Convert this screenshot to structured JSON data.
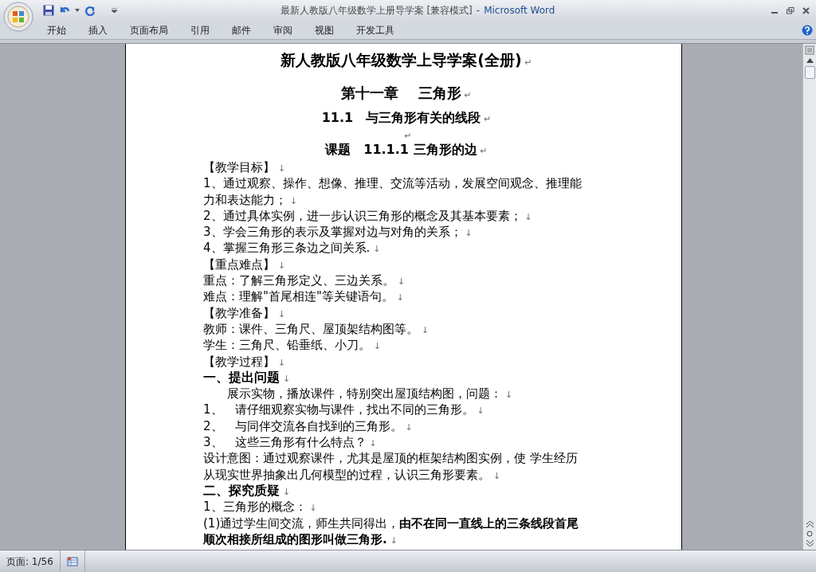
{
  "window": {
    "title": "最新人教版八年级数学上册导学案 [兼容模式]",
    "separator": "-",
    "app": "Microsoft Word"
  },
  "ribbon_tabs": [
    {
      "label": "开始",
      "selected": false
    },
    {
      "label": "插入",
      "selected": false
    },
    {
      "label": "页面布局",
      "selected": false
    },
    {
      "label": "引用",
      "selected": false
    },
    {
      "label": "邮件",
      "selected": false
    },
    {
      "label": "审阅",
      "selected": false
    },
    {
      "label": "视图",
      "selected": false
    },
    {
      "label": "开发工具",
      "selected": false
    }
  ],
  "document": {
    "paragraphs": [
      {
        "kind": "title",
        "lines": [
          "新人教版八年级数学上导学案(全册)"
        ],
        "mark": "↵"
      },
      {
        "kind": "chapter",
        "lines": [
          "第十一章　 三角形"
        ],
        "mark": "↵"
      },
      {
        "kind": "section",
        "lines": [
          "11.1　与三角形有关的线段"
        ],
        "mark": "↵"
      },
      {
        "kind": "blank",
        "mark": "↵"
      },
      {
        "kind": "lesson",
        "lines": [
          "课题　11.1.1 三角形的边"
        ],
        "mark": "↵"
      },
      {
        "kind": "body",
        "lines": [
          "【教学目标】"
        ],
        "mark": "↓"
      },
      {
        "kind": "body",
        "lines": [
          "1、通过观察、操作、想像、推理、交流等活动，发展空间观念、推理能",
          "力和表达能力；"
        ],
        "mark": "↓"
      },
      {
        "kind": "body",
        "lines": [
          "2、通过具体实例，进一步认识三角形的概念及其基本要素；"
        ],
        "mark": "↓"
      },
      {
        "kind": "body",
        "lines": [
          "3、学会三角形的表示及掌握对边与对角的关系；"
        ],
        "mark": "↓"
      },
      {
        "kind": "body",
        "lines": [
          "4、掌握三角形三条边之间关系."
        ],
        "mark": "↓"
      },
      {
        "kind": "body",
        "lines": [
          "【重点难点】"
        ],
        "mark": "↓"
      },
      {
        "kind": "body",
        "lines": [
          "重点：了解三角形定义、三边关系。"
        ],
        "mark": "↓"
      },
      {
        "kind": "body",
        "lines": [
          "难点：理解\"首尾相连\"等关键语句。"
        ],
        "mark": "↓"
      },
      {
        "kind": "body",
        "lines": [
          "【教学准备】"
        ],
        "mark": "↓"
      },
      {
        "kind": "body",
        "lines": [
          "教师：课件、三角尺、屋顶架结构图等。"
        ],
        "mark": "↓"
      },
      {
        "kind": "body",
        "lines": [
          "学生：三角尺、铅垂纸、小刀。"
        ],
        "mark": "↓"
      },
      {
        "kind": "body",
        "lines": [
          "【教学过程】"
        ],
        "mark": "↓"
      },
      {
        "kind": "heading",
        "lines": [
          "一、提出问题"
        ],
        "mark": "↓"
      },
      {
        "kind": "indent",
        "lines": [
          "展示实物，播放课件，特别突出屋顶结构图，问题："
        ],
        "mark": "↓"
      },
      {
        "kind": "body",
        "lines": [
          "1、　请仔细观察实物与课件，找出不同的三角形。"
        ],
        "mark": "↓"
      },
      {
        "kind": "body",
        "lines": [
          "2、　与同伴交流各自找到的三角形。"
        ],
        "mark": "↓"
      },
      {
        "kind": "body",
        "lines": [
          "3、　这些三角形有什么特点？"
        ],
        "mark": "↓"
      },
      {
        "kind": "body",
        "lines": [
          "设计意图：通过观察课件，尤其是屋顶的框架结构图实例，使 学生经历",
          "从现实世界抽象出几何模型的过程，认识三角形要素。"
        ],
        "mark": "↓"
      },
      {
        "kind": "heading",
        "lines": [
          "二、探究质疑"
        ],
        "mark": "↓"
      },
      {
        "kind": "body",
        "lines": [
          "1、三角形的概念："
        ],
        "mark": "↓"
      },
      {
        "kind": "body",
        "lines": [
          "(1)通过学生间交流，师生共同得出，**由不在同一直线上的三条线段首尾**",
          "**顺次相接所组成的图形叫做三角形.**"
        ],
        "mark": "↓"
      }
    ]
  },
  "status_bar": {
    "page": "页面: 1/56"
  }
}
